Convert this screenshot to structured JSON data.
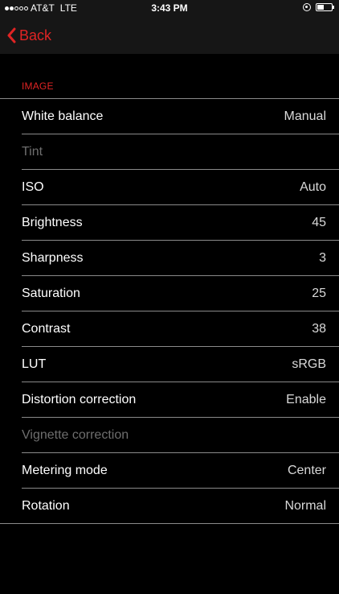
{
  "status_bar": {
    "signal_dots_filled": 2,
    "signal_dots_total": 5,
    "carrier": "AT&T",
    "network": "LTE",
    "time": "3:43 PM",
    "icons": [
      "orientation-lock-icon",
      "battery-icon"
    ],
    "battery_level_percent": 40
  },
  "nav": {
    "back_label": "Back",
    "accent_color": "#e02424"
  },
  "section": {
    "header": "IMAGE"
  },
  "rows": [
    {
      "label": "White balance",
      "value": "Manual",
      "disabled": false
    },
    {
      "label": "Tint",
      "value": "",
      "disabled": true
    },
    {
      "label": "ISO",
      "value": "Auto",
      "disabled": false
    },
    {
      "label": "Brightness",
      "value": "45",
      "disabled": false
    },
    {
      "label": "Sharpness",
      "value": "3",
      "disabled": false
    },
    {
      "label": "Saturation",
      "value": "25",
      "disabled": false
    },
    {
      "label": "Contrast",
      "value": "38",
      "disabled": false
    },
    {
      "label": "LUT",
      "value": "sRGB",
      "disabled": false
    },
    {
      "label": "Distortion correction",
      "value": "Enable",
      "disabled": false
    },
    {
      "label": "Vignette correction",
      "value": "",
      "disabled": true
    },
    {
      "label": "Metering mode",
      "value": "Center",
      "disabled": false
    },
    {
      "label": "Rotation",
      "value": "Normal",
      "disabled": false
    }
  ]
}
